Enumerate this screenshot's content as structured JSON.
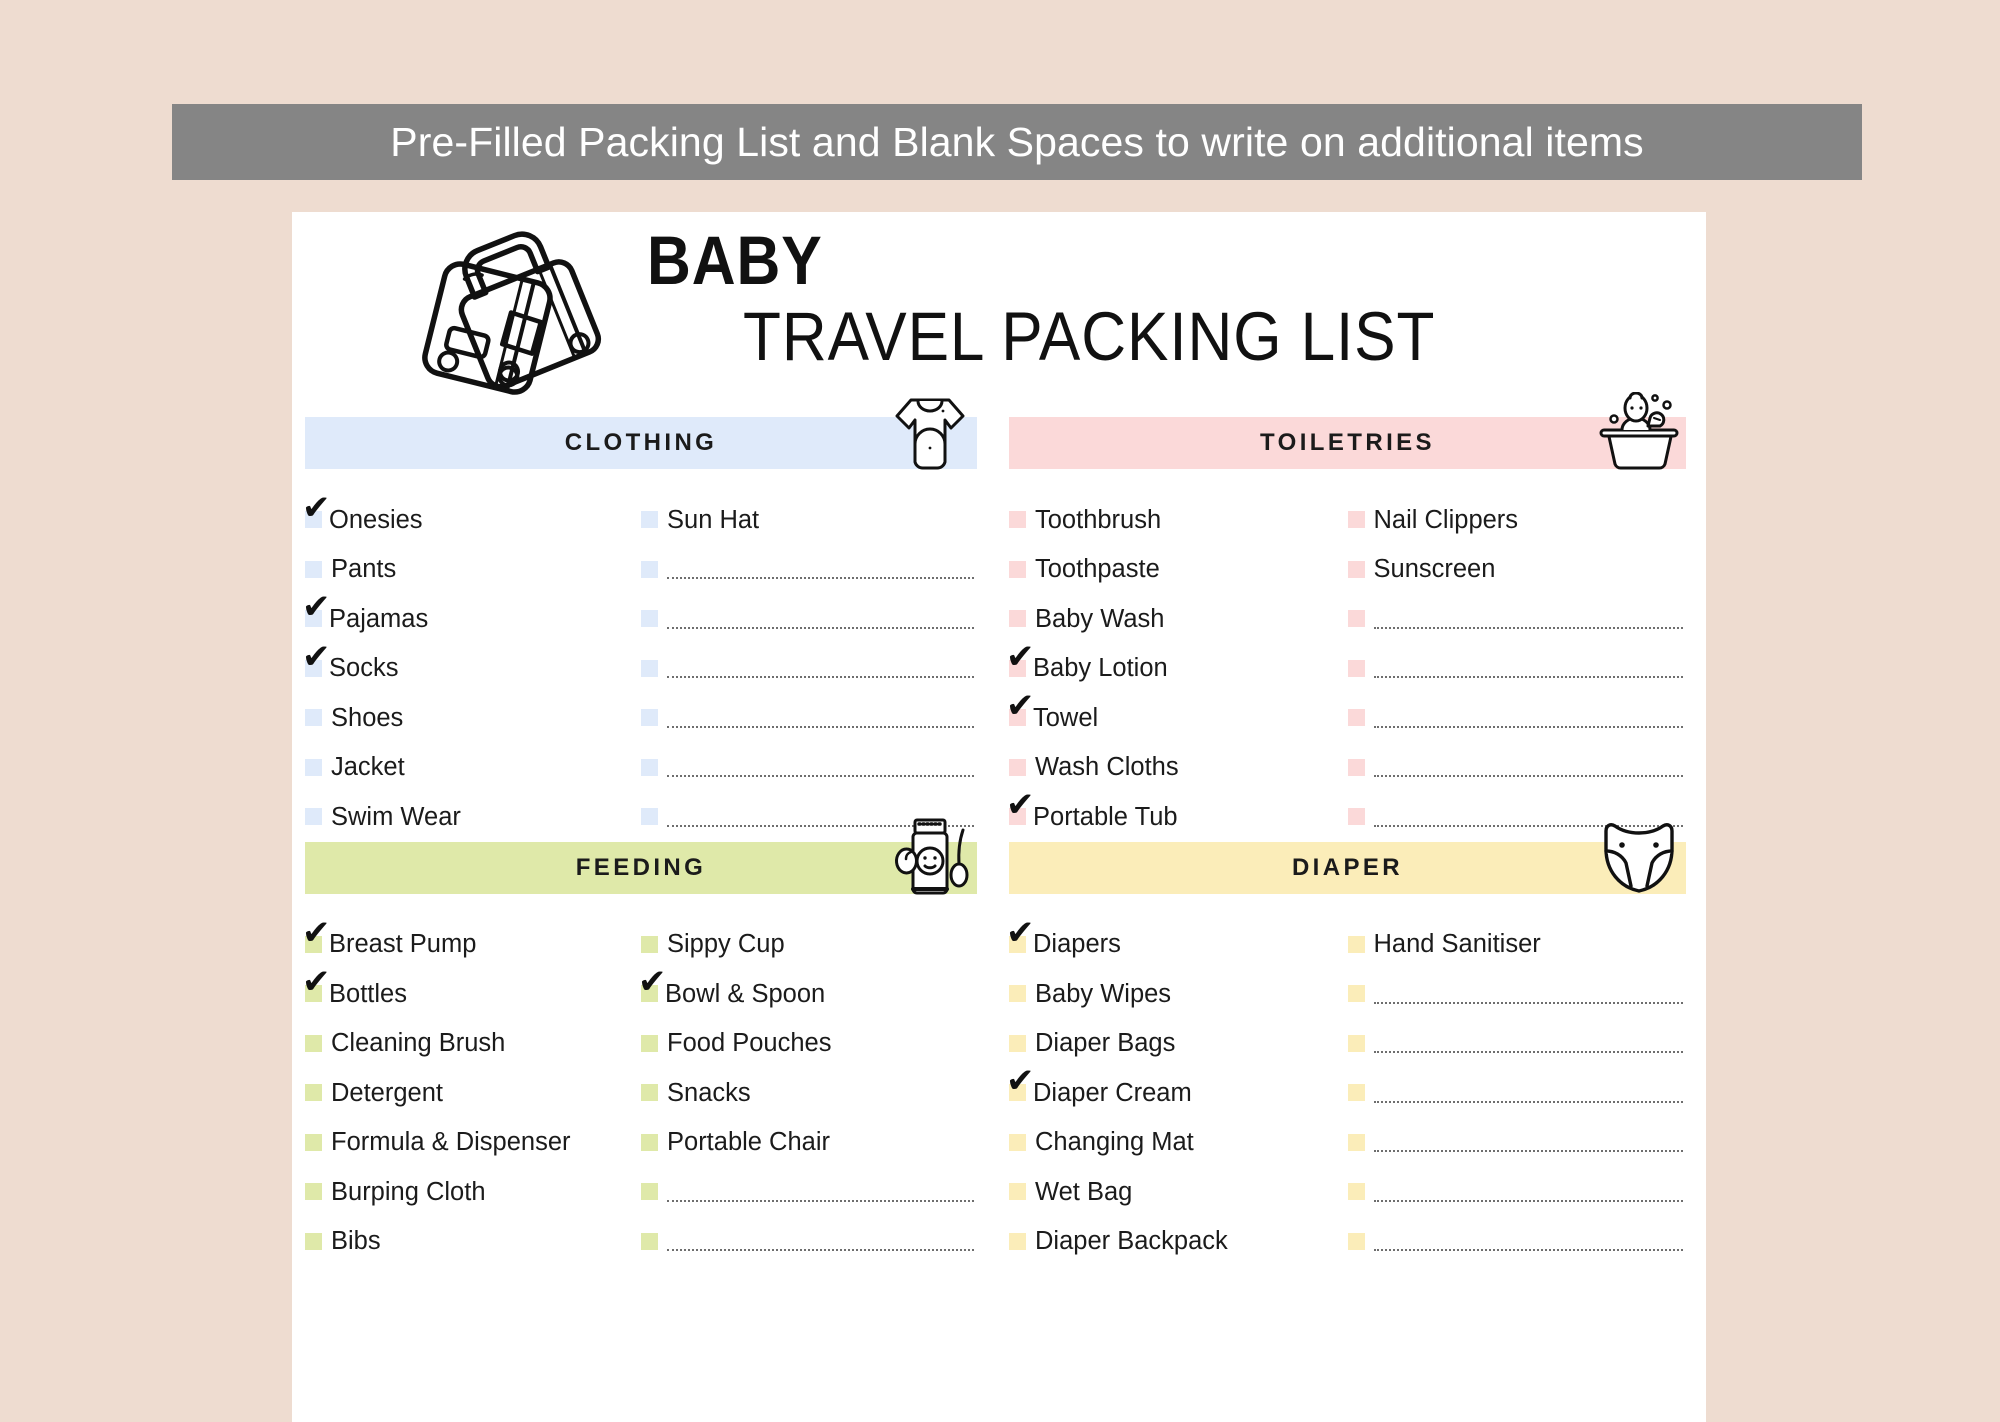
{
  "banner": {
    "text": "Pre-Filled Packing List and Blank Spaces to write on additional items"
  },
  "title": {
    "line1": "BABY",
    "line2": "TRAVEL PACKING LIST"
  },
  "colors": {
    "page_background": "#eedcd0",
    "banner_background": "#858585",
    "banner_text": "#ffffff",
    "sheet_background": "#ffffff",
    "clothing_accent": "#dfeafa",
    "toiletries_accent": "#fbd9d9",
    "feeding_accent": "#dfe9a9",
    "diaper_accent": "#fbedb9",
    "text": "#1b1b1b"
  },
  "sections": [
    {
      "key": "clothing",
      "title": "CLOTHING",
      "icon": "onesie-icon",
      "left_column": [
        {
          "label": "Onesies",
          "checked": true
        },
        {
          "label": "Pants",
          "checked": false
        },
        {
          "label": "Pajamas",
          "checked": true
        },
        {
          "label": "Socks",
          "checked": true
        },
        {
          "label": "Shoes",
          "checked": false
        },
        {
          "label": "Jacket",
          "checked": false
        },
        {
          "label": "Swim Wear",
          "checked": false
        }
      ],
      "right_column": [
        {
          "label": "Sun Hat",
          "checked": false
        },
        {
          "label": "",
          "checked": false,
          "blank": true
        },
        {
          "label": "",
          "checked": false,
          "blank": true
        },
        {
          "label": "",
          "checked": false,
          "blank": true
        },
        {
          "label": "",
          "checked": false,
          "blank": true
        },
        {
          "label": "",
          "checked": false,
          "blank": true
        },
        {
          "label": "",
          "checked": false,
          "blank": true
        }
      ]
    },
    {
      "key": "toiletries",
      "title": "TOILETRIES",
      "icon": "baby-bathtub-icon",
      "left_column": [
        {
          "label": "Toothbrush",
          "checked": false
        },
        {
          "label": "Toothpaste",
          "checked": false
        },
        {
          "label": "Baby Wash",
          "checked": false
        },
        {
          "label": "Baby Lotion",
          "checked": true
        },
        {
          "label": "Towel",
          "checked": true
        },
        {
          "label": "Wash Cloths",
          "checked": false
        },
        {
          "label": "Portable Tub",
          "checked": true
        }
      ],
      "right_column": [
        {
          "label": "Nail Clippers",
          "checked": false
        },
        {
          "label": "Sunscreen",
          "checked": false
        },
        {
          "label": "",
          "checked": false,
          "blank": true
        },
        {
          "label": "",
          "checked": false,
          "blank": true
        },
        {
          "label": "",
          "checked": false,
          "blank": true
        },
        {
          "label": "",
          "checked": false,
          "blank": true
        },
        {
          "label": "",
          "checked": false,
          "blank": true
        }
      ]
    },
    {
      "key": "feeding",
      "title": "FEEDING",
      "icon": "baby-food-jar-icon",
      "left_column": [
        {
          "label": "Breast Pump",
          "checked": true
        },
        {
          "label": "Bottles",
          "checked": true
        },
        {
          "label": "Cleaning Brush",
          "checked": false
        },
        {
          "label": "Detergent",
          "checked": false
        },
        {
          "label": "Formula & Dispenser",
          "checked": false
        },
        {
          "label": "Burping Cloth",
          "checked": false
        },
        {
          "label": "Bibs",
          "checked": false
        }
      ],
      "right_column": [
        {
          "label": "Sippy Cup",
          "checked": false
        },
        {
          "label": "Bowl & Spoon",
          "checked": true
        },
        {
          "label": "Food Pouches",
          "checked": false
        },
        {
          "label": "Snacks",
          "checked": false
        },
        {
          "label": "Portable Chair",
          "checked": false
        },
        {
          "label": "",
          "checked": false,
          "blank": true
        },
        {
          "label": "",
          "checked": false,
          "blank": true
        }
      ]
    },
    {
      "key": "diaper",
      "title": "DIAPER",
      "icon": "diaper-icon",
      "left_column": [
        {
          "label": "Diapers",
          "checked": true
        },
        {
          "label": "Baby Wipes",
          "checked": false
        },
        {
          "label": "Diaper Bags",
          "checked": false
        },
        {
          "label": "Diaper Cream",
          "checked": true
        },
        {
          "label": "Changing Mat",
          "checked": false
        },
        {
          "label": "Wet Bag",
          "checked": false
        },
        {
          "label": "Diaper Backpack",
          "checked": false
        }
      ],
      "right_column": [
        {
          "label": "Hand Sanitiser",
          "checked": false
        },
        {
          "label": "",
          "checked": false,
          "blank": true
        },
        {
          "label": "",
          "checked": false,
          "blank": true
        },
        {
          "label": "",
          "checked": false,
          "blank": true
        },
        {
          "label": "",
          "checked": false,
          "blank": true
        },
        {
          "label": "",
          "checked": false,
          "blank": true
        },
        {
          "label": "",
          "checked": false,
          "blank": true
        }
      ]
    }
  ],
  "checkmark_glyph": "✔"
}
